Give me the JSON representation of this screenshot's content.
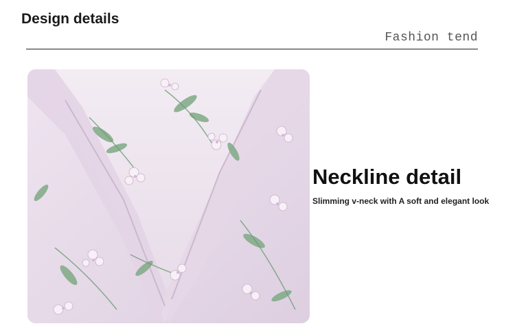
{
  "header": {
    "title": "Design details",
    "subtitle": "Fashion tend"
  },
  "detail": {
    "heading": "Neckline detail",
    "description": "Slimming v-neck with A soft and elegant look"
  },
  "photo": {
    "subject": "floral-fabric-v-neckline",
    "colors": {
      "fabric": "#e9dcea",
      "leaf": "#6f9c78",
      "flower": "#f6eef6"
    }
  }
}
